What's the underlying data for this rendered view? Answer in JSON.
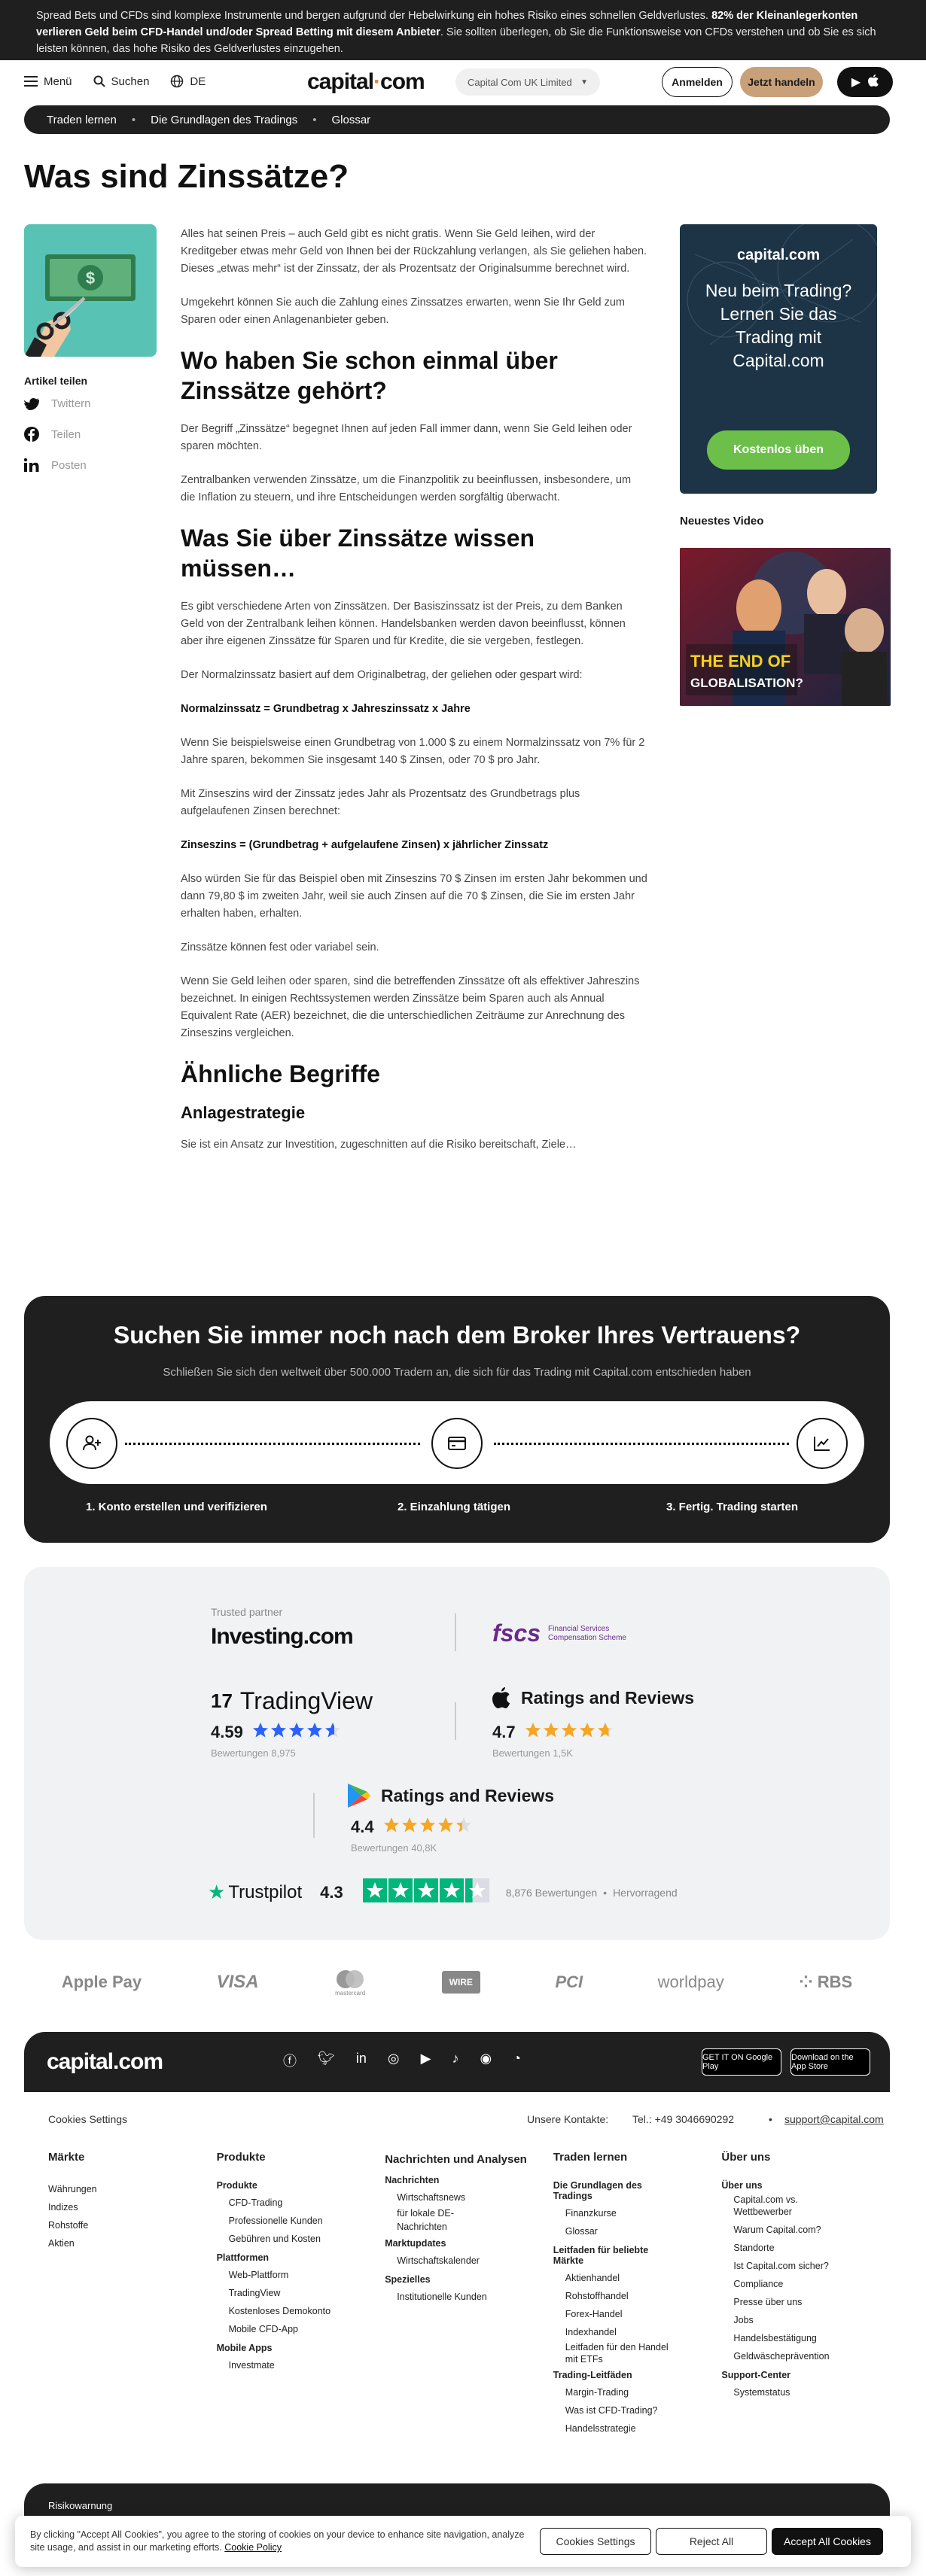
{
  "risk_banner": {
    "text_1": "Spread Bets und CFDs sind komplexe Instrumente und bergen aufgrund der Hebelwirkung ein hohes Risiko eines schnellen Geldverlustes. ",
    "bold": "82% der Kleinanlegerkonten verlieren Geld beim CFD-Handel und/oder Spread Betting mit diesem Anbieter",
    "text_2": ". Sie sollten überlegen, ob Sie die Funktionsweise von CFDs verstehen und ob Sie es sich leisten können, das hohe Risiko des Geldverlustes einzugehen."
  },
  "header": {
    "menu_label": "Menü",
    "search_label": "Suchen",
    "lang_label": "DE",
    "logo_text": "capital",
    "logo_suffix": "com",
    "entity_label": "Capital Com UK Limited",
    "login_label": "Anmelden",
    "trade_label": "Jetzt handeln"
  },
  "breadcrumb": {
    "items": [
      "Traden lernen",
      "Die Grundlagen des Tradings",
      "Glossar"
    ]
  },
  "page_title": "Was sind Zinssätze?",
  "share": {
    "heading": "Artikel teilen",
    "twitter": "Twittern",
    "facebook": "Teilen",
    "linkedin": "Posten"
  },
  "article": {
    "p1": "Alles hat seinen Preis – auch Geld gibt es nicht gratis. Wenn Sie Geld leihen, wird der Kreditgeber etwas mehr Geld von Ihnen bei der Rückzahlung verlangen, als Sie geliehen haben. Dieses „etwas mehr“ ist der Zinssatz, der als Prozentsatz der Originalsumme berechnet wird.",
    "p2": "Umgekehrt können Sie auch die Zahlung eines Zinssatzes erwarten, wenn Sie Ihr Geld zum Sparen oder einen Anlagenanbieter geben.",
    "h2_1": "Wo haben Sie schon einmal über Zinssätze gehört?",
    "p3": "Der Begriff „Zinssätze“ begegnet Ihnen auf jeden Fall immer dann, wenn Sie Geld leihen oder sparen möchten.",
    "p4": "Zentralbanken verwenden Zinssätze, um die Finanzpolitik zu beeinflussen, insbesondere, um die Inflation zu steuern, und ihre Entscheidungen werden sorgfältig überwacht.",
    "h2_2": "Was Sie über Zinssätze wissen müssen…",
    "p5": "Es gibt verschiedene Arten von Zinssätzen. Der Basiszinssatz ist der Preis, zu dem Banken Geld von der Zentralbank leihen können. Handelsbanken werden davon beeinflusst, können aber ihre eigenen Zinssätze für Sparen und für Kredite, die sie vergeben, festlegen.",
    "p6": "Der Normalzinssatz basiert auf dem Originalbetrag, der geliehen oder gespart wird:",
    "f1": "Normalzinssatz = Grundbetrag x Jahreszinssatz x Jahre",
    "p7": "Wenn Sie beispielsweise einen Grundbetrag von 1.000 $ zu einem Normalzinssatz von 7% für 2 Jahre sparen, bekommen Sie insgesamt 140 $ Zinsen, oder 70 $ pro Jahr.",
    "p8": "Mit Zinseszins wird der Zinssatz jedes Jahr als Prozentsatz des Grundbetrags plus aufgelaufenen Zinsen berechnet:",
    "f2": "Zinseszins = (Grundbetrag + aufgelaufene Zinsen) x jährlicher Zinssatz",
    "p9": "Also würden Sie für das Beispiel oben mit Zinseszins 70 $ Zinsen im ersten Jahr bekommen und dann 79,80 $ im zweiten Jahr, weil sie auch Zinsen auf die 70 $ Zinsen, die Sie im ersten Jahr erhalten haben, erhalten.",
    "p10": "Zinssätze können fest oder variabel sein.",
    "p11": "Wenn Sie Geld leihen oder sparen, sind die betreffenden Zinssätze oft als effektiver Jahreszins bezeichnet. In einigen Rechtssystemen werden Zinssätze beim Sparen auch als Annual Equivalent Rate (AER) bezeichnet, die die unterschiedlichen Zeiträume zur Anrechnung des Zinseszins vergleichen.",
    "h2_3": "Ähnliche Begriffe",
    "h3_1": "Anlagestrategie",
    "p12": "Sie ist ein Ansatz zur Investition, zugeschnitten auf die Risiko  bereitschaft, Ziele…"
  },
  "promo": {
    "logo": "capital.com",
    "text": "Neu beim Trading? Lernen Sie das Trading mit Capital.com",
    "button": "Kostenlos üben"
  },
  "video": {
    "heading": "Neuestes Video",
    "overlay_line1": "THE END OF",
    "overlay_line2": "GLOBALISATION?"
  },
  "broker": {
    "title": "Suchen Sie immer noch nach dem Broker Ihres Vertrauens?",
    "subtitle": "Schließen Sie sich den weltweit über 500.000 Tradern an, die sich für das Trading mit Capital.com entschieden haben",
    "steps": [
      "1. Konto erstellen und verifizieren",
      "2. Einzahlung tätigen",
      "3. Fertig. Trading starten"
    ]
  },
  "trust": {
    "partner_label": "Trusted partner",
    "investing": "Investing.com",
    "fscs": "fscs",
    "fscs_sub_1": "Financial Services",
    "fscs_sub_2": "Compensation Scheme",
    "tradingview": "TradingView",
    "tv_rating": "4.59",
    "tv_reviews": "Bewertungen 8,975",
    "apple_title": "Ratings and Reviews",
    "apple_rating": "4.7",
    "apple_reviews": "Bewertungen 1,5K",
    "google_title": "Ratings and Reviews",
    "google_rating": "4.4",
    "google_reviews": "Bewertungen 40,8K",
    "trustpilot": "Trustpilot",
    "tp_rating": "4.3",
    "tp_reviews": "8,876 Bewertungen",
    "tp_label": "Hervorragend",
    "tv_stars": 4.59,
    "apple_stars": 4.7,
    "google_stars": 4.4,
    "tp_stars": 4.3
  },
  "payments": [
    "Apple Pay",
    "VISA",
    "mastercard",
    "WIRE",
    "PCI",
    "worldpay",
    "RBS"
  ],
  "footer": {
    "logo": "capital.com",
    "store_google": "GET IT ON Google Play",
    "store_apple": "Download on the App Store",
    "cookie_settings": "Cookies Settings",
    "contact_label": "Unsere Kontakte:",
    "phone": "Tel.: +49 3046690292",
    "email": "support@capital.com",
    "col1_title": "Märkte",
    "col1": [
      "Währungen",
      "Indizes",
      "Rohstoffe",
      "Aktien"
    ],
    "col2_title": "Produkte",
    "col2_g1": "Produkte",
    "col2_i1": [
      "CFD-Trading",
      "Professionelle Kunden",
      "Gebühren und Kosten"
    ],
    "col2_g2": "Plattformen",
    "col2_i2": [
      "Web-Plattform",
      "TradingView",
      "Kostenloses Demokonto",
      "Mobile CFD-App"
    ],
    "col2_g3": "Mobile Apps",
    "col2_i3": [
      "Investmate"
    ],
    "col3_title": "Nachrichten und Analysen",
    "col3_g1": "Nachrichten",
    "col3_i1": [
      "Wirtschaftsnews",
      "für lokale DE-Nachrichten"
    ],
    "col3_g2": "Marktupdates",
    "col3_i2": [
      "Wirtschaftskalender"
    ],
    "col3_g3": "Spezielles",
    "col3_i3": [
      "Institutionelle Kunden"
    ],
    "col4_title": "Traden lernen",
    "col4_g1": "Die Grundlagen des Tradings",
    "col4_i1": [
      "Finanzkurse",
      "Glossar"
    ],
    "col4_g2": "Leitfaden für beliebte Märkte",
    "col4_i2": [
      "Aktienhandel",
      "Rohstoffhandel",
      "Forex-Handel",
      "Indexhandel",
      "Leitfaden für den Handel mit ETFs"
    ],
    "col4_g3": "Trading-Leitfäden",
    "col4_i3": [
      "Margin-Trading",
      "Was ist CFD-Trading?",
      "Handelsstrategie"
    ],
    "col5_title": "Über uns",
    "col5_g1": "Über uns",
    "col5_i1": [
      "Capital.com vs. Wettbewerber",
      "Warum Capital.com?",
      "Standorte",
      "Ist Capital.com sicher?",
      "Compliance",
      "Presse über uns",
      "Jobs",
      "Handelsbestätigung",
      "Geldwäscheprävention"
    ],
    "col5_g2": "Support-Center",
    "col5_i2": [
      "Systemstatus"
    ],
    "risk_warning": "Risikowarnung"
  },
  "cookie_banner": {
    "text": "By clicking \"Accept All Cookies\", you agree to the storing of cookies on your device to enhance site navigation, analyze site usage, and assist in our marketing efforts.",
    "policy_link": "Cookie Policy",
    "settings_btn": "Cookies Settings",
    "reject_btn": "Reject All",
    "accept_btn": "Accept All Cookies"
  },
  "colors": {
    "dark": "#1f1f1f",
    "accent_orange": "#f07b3f",
    "trade_btn": "#c8a07a",
    "promo_bg": "#1d3447",
    "promo_btn": "#6cc04a",
    "star_blue": "#2962ff",
    "star_orange": "#f5a623",
    "trustpilot_green": "#00b67a"
  }
}
